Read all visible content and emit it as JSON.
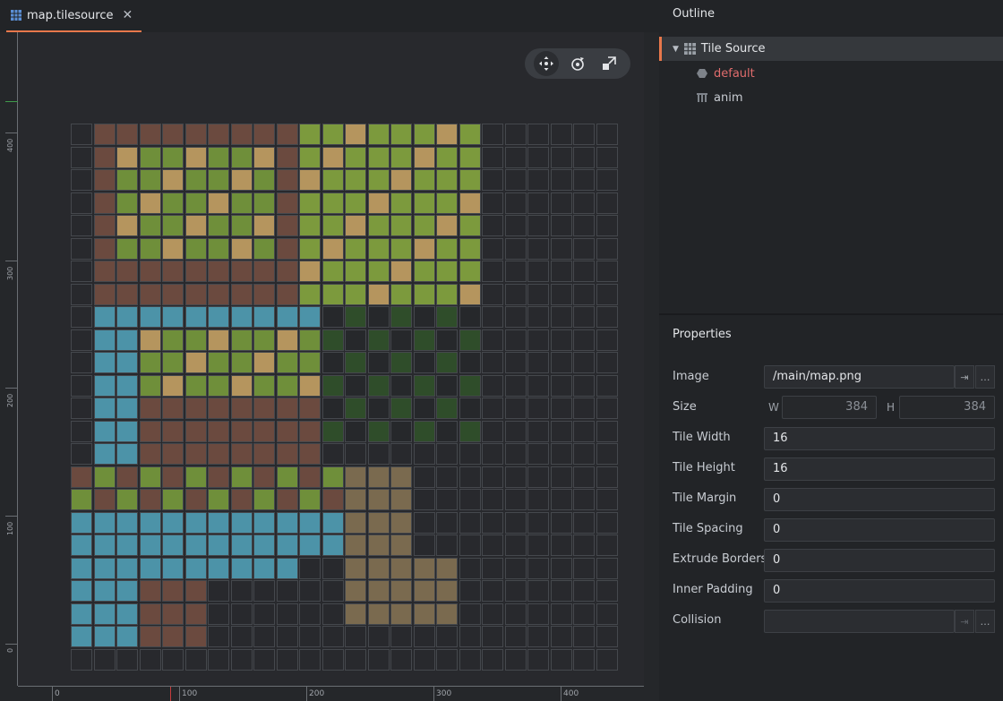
{
  "tab": {
    "title": "map.tilesource",
    "icon": "tilesource-icon",
    "close": "✕",
    "accent": "#e8784b"
  },
  "rulers": {
    "vertical": [
      "400",
      "300",
      "200",
      "100",
      "0"
    ],
    "horizontal": [
      "0",
      "100",
      "200",
      "300",
      "400"
    ]
  },
  "toolbar": {
    "tools": [
      "move-tool-icon",
      "rotate-tool-icon",
      "scale-tool-icon"
    ]
  },
  "outline": {
    "title": "Outline",
    "root": "Tile Source",
    "items": [
      {
        "label": "default",
        "icon": "collision-group-icon",
        "color": "#e06c6c"
      },
      {
        "label": "anim",
        "icon": "animation-icon",
        "color": "#c8ccd2"
      }
    ]
  },
  "properties": {
    "title": "Properties",
    "image": {
      "label": "Image",
      "value": "/main/map.png",
      "goto": "⇥",
      "browse": "…"
    },
    "size": {
      "label": "Size",
      "w_label": "W",
      "w": "384",
      "h_label": "H",
      "h": "384"
    },
    "tile_width": {
      "label": "Tile Width",
      "value": "16"
    },
    "tile_height": {
      "label": "Tile Height",
      "value": "16"
    },
    "tile_margin": {
      "label": "Tile Margin",
      "value": "0"
    },
    "tile_spacing": {
      "label": "Tile Spacing",
      "value": "0"
    },
    "extrude_borders": {
      "label": "Extrude Borders",
      "value": "0"
    },
    "inner_padding": {
      "label": "Inner Padding",
      "value": "0"
    },
    "collision": {
      "label": "Collision",
      "value": "",
      "goto": "⇥",
      "browse": "…"
    }
  },
  "tilegrid": {
    "columns": 24,
    "rows": 24
  }
}
